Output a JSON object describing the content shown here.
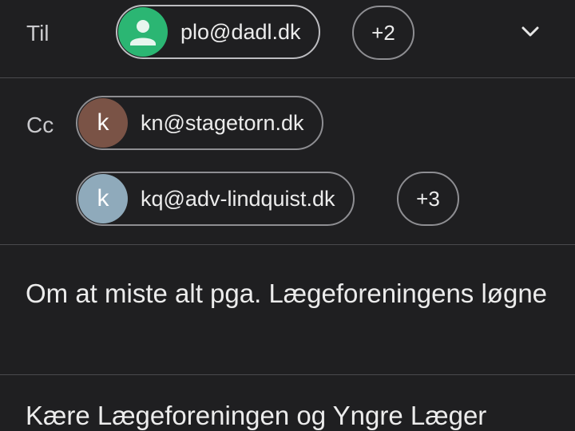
{
  "to": {
    "label": "Til",
    "recipients": [
      {
        "avatar_type": "person-icon",
        "avatar_color": "#2bb673",
        "email": "plo@dadl.dk",
        "selected": true
      }
    ],
    "more_label": "+2",
    "expand_icon": "chevron-down-icon"
  },
  "cc": {
    "label": "Cc",
    "recipients": [
      {
        "avatar_letter": "k",
        "avatar_color": "#7a5346",
        "email": "kn@stagetorn.dk"
      },
      {
        "avatar_letter": "k",
        "avatar_color": "#8faabb",
        "email": "kq@adv-lindquist.dk"
      }
    ],
    "more_label": "+3"
  },
  "subject": "Om at miste alt pga. Lægeforeningens løgne",
  "body": {
    "first_line": "Kære Lægeforeningen og Yngre Læger"
  }
}
